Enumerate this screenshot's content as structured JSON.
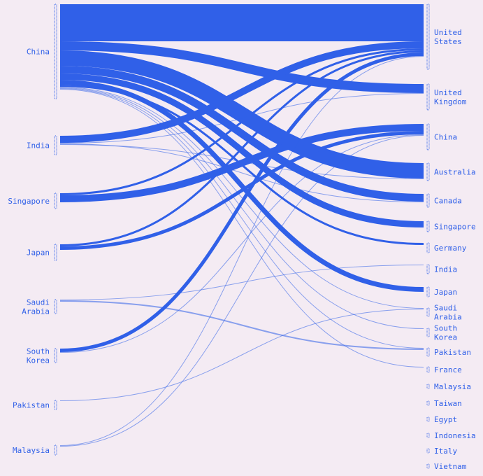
{
  "chart_data": {
    "type": "sankey",
    "title": "",
    "colors": {
      "background": "#f4ebf3",
      "flow": "#3060e8",
      "text": "#3060e8"
    },
    "sources": [
      {
        "id": "s_china",
        "label": [
          "China"
        ],
        "value": 135
      },
      {
        "id": "s_india",
        "label": [
          "India"
        ],
        "value": 27
      },
      {
        "id": "s_singapore",
        "label": [
          "Singapore"
        ],
        "value": 22
      },
      {
        "id": "s_japan",
        "label": [
          "Japan"
        ],
        "value": 23
      },
      {
        "id": "s_saudi",
        "label": [
          "Saudi",
          "Arabia"
        ],
        "value": 20
      },
      {
        "id": "s_skorea",
        "label": [
          "South",
          "Korea"
        ],
        "value": 20
      },
      {
        "id": "s_pakistan",
        "label": [
          "Pakistan"
        ],
        "value": 13
      },
      {
        "id": "s_malaysia",
        "label": [
          "Malaysia"
        ],
        "value": 14
      }
    ],
    "targets": [
      {
        "id": "t_us",
        "label": [
          "United",
          "States"
        ]
      },
      {
        "id": "t_uk",
        "label": [
          "United",
          "Kingdom"
        ]
      },
      {
        "id": "t_china",
        "label": [
          "China"
        ]
      },
      {
        "id": "t_australia",
        "label": [
          "Australia"
        ]
      },
      {
        "id": "t_canada",
        "label": [
          "Canada"
        ]
      },
      {
        "id": "t_singapore",
        "label": [
          "Singapore"
        ]
      },
      {
        "id": "t_germany",
        "label": [
          "Germany"
        ]
      },
      {
        "id": "t_india",
        "label": [
          "India"
        ]
      },
      {
        "id": "t_japan",
        "label": [
          "Japan"
        ]
      },
      {
        "id": "t_saudi",
        "label": [
          "Saudi",
          "Arabia"
        ]
      },
      {
        "id": "t_skorea",
        "label": [
          "South",
          "Korea"
        ]
      },
      {
        "id": "t_pakistan",
        "label": [
          "Pakistan"
        ]
      },
      {
        "id": "t_france",
        "label": [
          "France"
        ]
      },
      {
        "id": "t_malaysia",
        "label": [
          "Malaysia"
        ]
      },
      {
        "id": "t_taiwan",
        "label": [
          "Taiwan"
        ]
      },
      {
        "id": "t_egypt",
        "label": [
          "Egypt"
        ]
      },
      {
        "id": "t_indonesia",
        "label": [
          "Indonesia"
        ]
      },
      {
        "id": "t_italy",
        "label": [
          "Italy"
        ]
      },
      {
        "id": "t_vietnam",
        "label": [
          "Vietnam"
        ]
      }
    ],
    "flows": [
      {
        "source": "s_china",
        "target": "t_us",
        "value": 53
      },
      {
        "source": "s_china",
        "target": "t_uk",
        "value": 13
      },
      {
        "source": "s_china",
        "target": "t_australia",
        "value": 22
      },
      {
        "source": "s_china",
        "target": "t_canada",
        "value": 11
      },
      {
        "source": "s_china",
        "target": "t_singapore",
        "value": 9
      },
      {
        "source": "s_china",
        "target": "t_japan",
        "value": 7
      },
      {
        "source": "s_china",
        "target": "t_germany",
        "value": 3
      },
      {
        "source": "s_china",
        "target": "t_saudi",
        "value": 1
      },
      {
        "source": "s_china",
        "target": "t_skorea",
        "value": 1
      },
      {
        "source": "s_china",
        "target": "t_pakistan",
        "value": 1
      },
      {
        "source": "s_china",
        "target": "t_france",
        "value": 1
      },
      {
        "source": "s_india",
        "target": "t_us",
        "value": 10
      },
      {
        "source": "s_india",
        "target": "t_uk",
        "value": 1
      },
      {
        "source": "s_india",
        "target": "t_canada",
        "value": 1
      },
      {
        "source": "s_india",
        "target": "t_australia",
        "value": 1
      },
      {
        "source": "s_singapore",
        "target": "t_us",
        "value": 3
      },
      {
        "source": "s_singapore",
        "target": "t_china",
        "value": 10
      },
      {
        "source": "s_japan",
        "target": "t_us",
        "value": 3
      },
      {
        "source": "s_japan",
        "target": "t_china",
        "value": 5
      },
      {
        "source": "s_saudi",
        "target": "t_india",
        "value": 1
      },
      {
        "source": "s_saudi",
        "target": "t_pakistan",
        "value": 2
      },
      {
        "source": "s_skorea",
        "target": "t_us",
        "value": 5
      },
      {
        "source": "s_skorea",
        "target": "t_china",
        "value": 1
      },
      {
        "source": "s_pakistan",
        "target": "t_saudi",
        "value": 1
      },
      {
        "source": "s_malaysia",
        "target": "t_us",
        "value": 1
      },
      {
        "source": "s_malaysia",
        "target": "t_china",
        "value": 1
      }
    ]
  }
}
